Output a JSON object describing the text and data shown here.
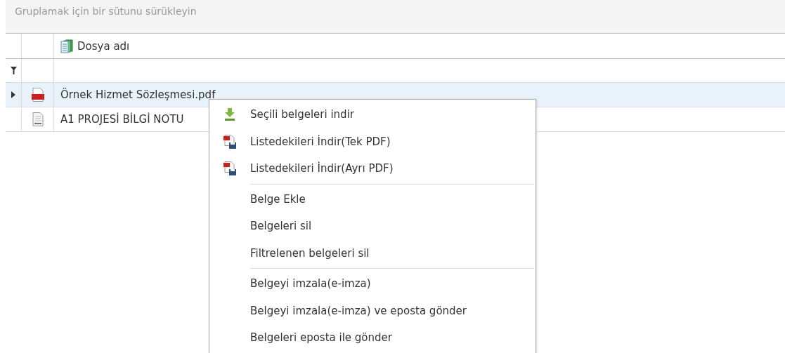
{
  "group_panel": {
    "hint": "Gruplamak için bir sütunu sürükleyin"
  },
  "grid": {
    "columns": [
      {
        "label": "Dosya adı"
      }
    ],
    "rows": [
      {
        "file_name": "Örnek Hizmet Sözleşmesi.pdf",
        "kind": "pdf",
        "selected": true
      },
      {
        "file_name": "A1 PROJESİ BİLGİ NOTU",
        "kind": "docx",
        "selected": false
      }
    ]
  },
  "context_menu": {
    "groups": [
      [
        {
          "label": "Seçili belgeleri indir",
          "kind": "download"
        },
        {
          "label": "Listedekileri İndir(Tek PDF)",
          "kind": "pdf-save"
        },
        {
          "label": "Listedekileri İndir(Ayrı PDF)",
          "kind": "pdf-save"
        }
      ],
      [
        {
          "label": "Belge Ekle",
          "kind": "plain"
        },
        {
          "label": "Belgeleri sil",
          "kind": "plain"
        },
        {
          "label": "Filtrelenen belgeleri sil",
          "kind": "plain"
        }
      ],
      [
        {
          "label": "Belgeyi imzala(e-imza)",
          "kind": "plain"
        },
        {
          "label": "Belgeyi imzala(e-imza) ve eposta gönder",
          "kind": "plain"
        },
        {
          "label": "Belgeleri eposta ile gönder",
          "kind": "plain"
        }
      ]
    ]
  }
}
